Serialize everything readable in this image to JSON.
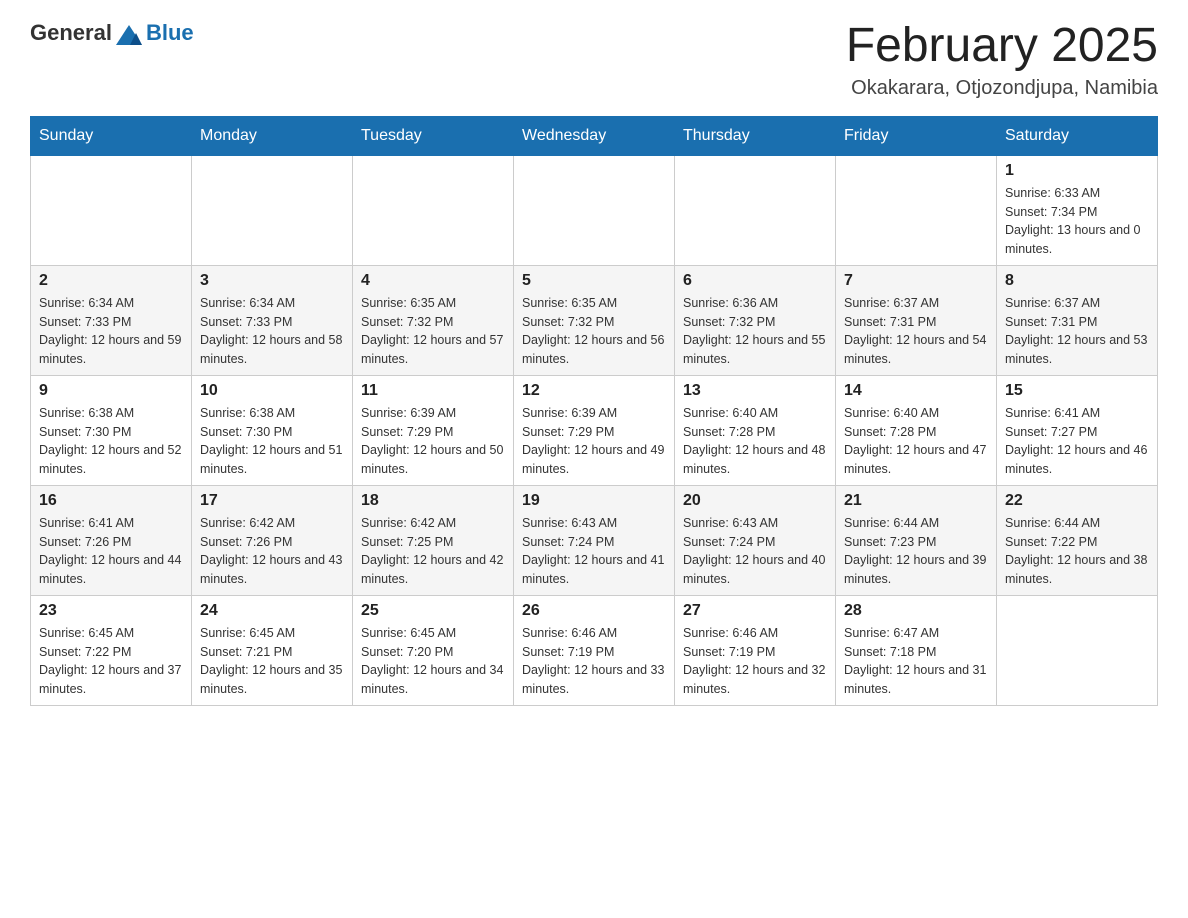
{
  "header": {
    "logo_general": "General",
    "logo_blue": "Blue",
    "month_title": "February 2025",
    "subtitle": "Okakarara, Otjozondjupa, Namibia"
  },
  "days_of_week": [
    "Sunday",
    "Monday",
    "Tuesday",
    "Wednesday",
    "Thursday",
    "Friday",
    "Saturday"
  ],
  "weeks": [
    {
      "days": [
        {
          "number": "",
          "info": ""
        },
        {
          "number": "",
          "info": ""
        },
        {
          "number": "",
          "info": ""
        },
        {
          "number": "",
          "info": ""
        },
        {
          "number": "",
          "info": ""
        },
        {
          "number": "",
          "info": ""
        },
        {
          "number": "1",
          "info": "Sunrise: 6:33 AM\nSunset: 7:34 PM\nDaylight: 13 hours and 0 minutes."
        }
      ]
    },
    {
      "days": [
        {
          "number": "2",
          "info": "Sunrise: 6:34 AM\nSunset: 7:33 PM\nDaylight: 12 hours and 59 minutes."
        },
        {
          "number": "3",
          "info": "Sunrise: 6:34 AM\nSunset: 7:33 PM\nDaylight: 12 hours and 58 minutes."
        },
        {
          "number": "4",
          "info": "Sunrise: 6:35 AM\nSunset: 7:32 PM\nDaylight: 12 hours and 57 minutes."
        },
        {
          "number": "5",
          "info": "Sunrise: 6:35 AM\nSunset: 7:32 PM\nDaylight: 12 hours and 56 minutes."
        },
        {
          "number": "6",
          "info": "Sunrise: 6:36 AM\nSunset: 7:32 PM\nDaylight: 12 hours and 55 minutes."
        },
        {
          "number": "7",
          "info": "Sunrise: 6:37 AM\nSunset: 7:31 PM\nDaylight: 12 hours and 54 minutes."
        },
        {
          "number": "8",
          "info": "Sunrise: 6:37 AM\nSunset: 7:31 PM\nDaylight: 12 hours and 53 minutes."
        }
      ]
    },
    {
      "days": [
        {
          "number": "9",
          "info": "Sunrise: 6:38 AM\nSunset: 7:30 PM\nDaylight: 12 hours and 52 minutes."
        },
        {
          "number": "10",
          "info": "Sunrise: 6:38 AM\nSunset: 7:30 PM\nDaylight: 12 hours and 51 minutes."
        },
        {
          "number": "11",
          "info": "Sunrise: 6:39 AM\nSunset: 7:29 PM\nDaylight: 12 hours and 50 minutes."
        },
        {
          "number": "12",
          "info": "Sunrise: 6:39 AM\nSunset: 7:29 PM\nDaylight: 12 hours and 49 minutes."
        },
        {
          "number": "13",
          "info": "Sunrise: 6:40 AM\nSunset: 7:28 PM\nDaylight: 12 hours and 48 minutes."
        },
        {
          "number": "14",
          "info": "Sunrise: 6:40 AM\nSunset: 7:28 PM\nDaylight: 12 hours and 47 minutes."
        },
        {
          "number": "15",
          "info": "Sunrise: 6:41 AM\nSunset: 7:27 PM\nDaylight: 12 hours and 46 minutes."
        }
      ]
    },
    {
      "days": [
        {
          "number": "16",
          "info": "Sunrise: 6:41 AM\nSunset: 7:26 PM\nDaylight: 12 hours and 44 minutes."
        },
        {
          "number": "17",
          "info": "Sunrise: 6:42 AM\nSunset: 7:26 PM\nDaylight: 12 hours and 43 minutes."
        },
        {
          "number": "18",
          "info": "Sunrise: 6:42 AM\nSunset: 7:25 PM\nDaylight: 12 hours and 42 minutes."
        },
        {
          "number": "19",
          "info": "Sunrise: 6:43 AM\nSunset: 7:24 PM\nDaylight: 12 hours and 41 minutes."
        },
        {
          "number": "20",
          "info": "Sunrise: 6:43 AM\nSunset: 7:24 PM\nDaylight: 12 hours and 40 minutes."
        },
        {
          "number": "21",
          "info": "Sunrise: 6:44 AM\nSunset: 7:23 PM\nDaylight: 12 hours and 39 minutes."
        },
        {
          "number": "22",
          "info": "Sunrise: 6:44 AM\nSunset: 7:22 PM\nDaylight: 12 hours and 38 minutes."
        }
      ]
    },
    {
      "days": [
        {
          "number": "23",
          "info": "Sunrise: 6:45 AM\nSunset: 7:22 PM\nDaylight: 12 hours and 37 minutes."
        },
        {
          "number": "24",
          "info": "Sunrise: 6:45 AM\nSunset: 7:21 PM\nDaylight: 12 hours and 35 minutes."
        },
        {
          "number": "25",
          "info": "Sunrise: 6:45 AM\nSunset: 7:20 PM\nDaylight: 12 hours and 34 minutes."
        },
        {
          "number": "26",
          "info": "Sunrise: 6:46 AM\nSunset: 7:19 PM\nDaylight: 12 hours and 33 minutes."
        },
        {
          "number": "27",
          "info": "Sunrise: 6:46 AM\nSunset: 7:19 PM\nDaylight: 12 hours and 32 minutes."
        },
        {
          "number": "28",
          "info": "Sunrise: 6:47 AM\nSunset: 7:18 PM\nDaylight: 12 hours and 31 minutes."
        },
        {
          "number": "",
          "info": ""
        }
      ]
    }
  ]
}
